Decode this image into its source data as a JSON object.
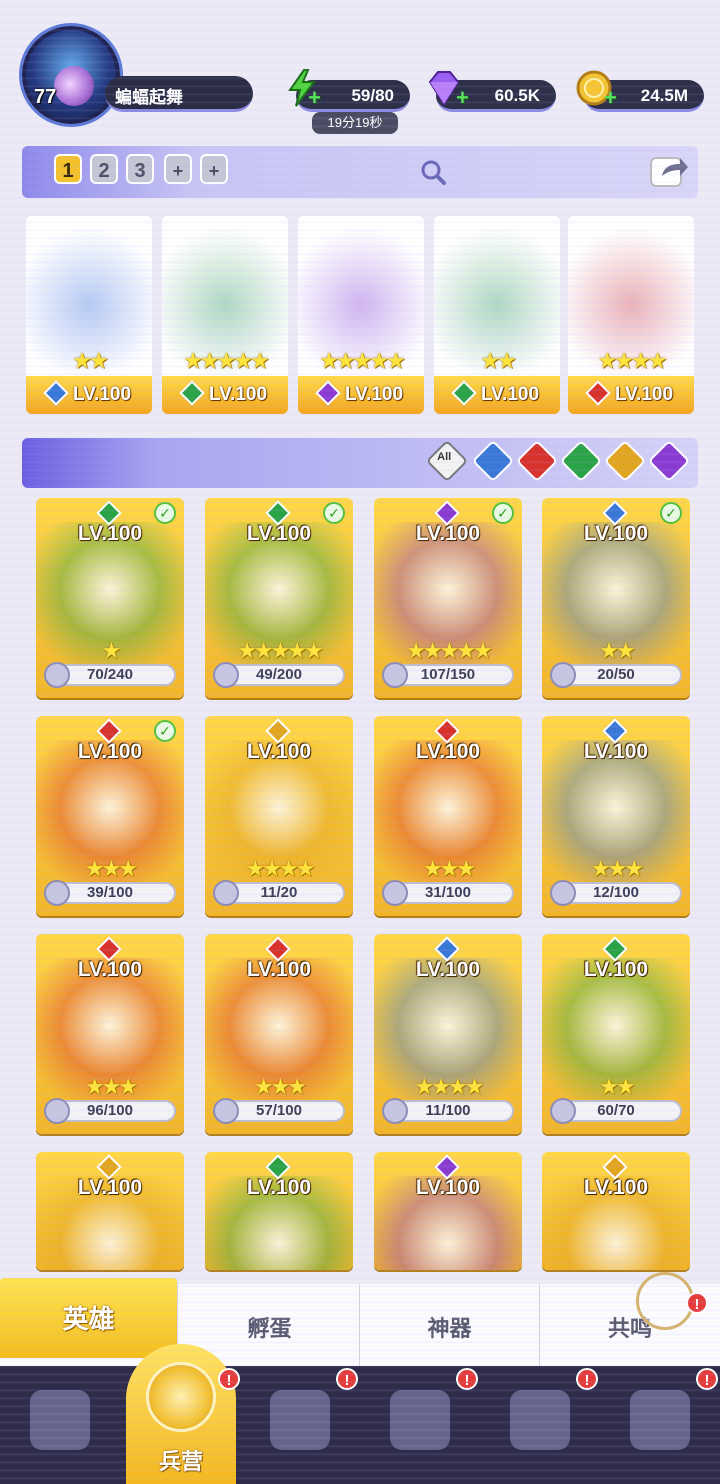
{
  "player": {
    "level": "77",
    "name": "蝙蝠起舞"
  },
  "resources": {
    "energy": {
      "value": "59/80",
      "timer": "19分19秒",
      "icon": "lightning-icon"
    },
    "gems": {
      "value": "60.5K",
      "icon": "gem-icon"
    },
    "coins": {
      "value": "24.5M",
      "icon": "coin-icon"
    }
  },
  "team_tabs": [
    "1",
    "2",
    "3",
    "+",
    "+"
  ],
  "team": [
    {
      "level": "LV.100",
      "stars": "★★",
      "element": "water",
      "color": "#3a78d8"
    },
    {
      "level": "LV.100",
      "stars": "★★★★★",
      "element": "nature",
      "color": "#2aa346"
    },
    {
      "level": "LV.100",
      "stars": "★★★★★",
      "element": "dark",
      "color": "#8a3bd0"
    },
    {
      "level": "LV.100",
      "stars": "★★",
      "element": "nature",
      "color": "#2aa346"
    },
    {
      "level": "LV.100",
      "stars": "★★★★",
      "element": "fire",
      "color": "#d8322c"
    }
  ],
  "filter": {
    "all_label": "All"
  },
  "heroes": [
    {
      "level": "LV.100",
      "shards": "70/240",
      "stars": "★",
      "element": "nature",
      "color": "#2aa346",
      "checked": true
    },
    {
      "level": "LV.100",
      "shards": "49/200",
      "stars": "★★★★★",
      "element": "nature",
      "color": "#2aa346",
      "checked": true
    },
    {
      "level": "LV.100",
      "shards": "107/150",
      "stars": "★★★★★",
      "element": "dark",
      "color": "#8a3bd0",
      "checked": true
    },
    {
      "level": "LV.100",
      "shards": "20/50",
      "stars": "★★",
      "element": "water",
      "color": "#3a78d8",
      "checked": true
    },
    {
      "level": "LV.100",
      "shards": "39/100",
      "stars": "★★★",
      "element": "fire",
      "color": "#d8322c",
      "checked": true
    },
    {
      "level": "LV.100",
      "shards": "11/20",
      "stars": "★★★★",
      "element": "light",
      "color": "#e2a51f",
      "checked": false
    },
    {
      "level": "LV.100",
      "shards": "31/100",
      "stars": "★★★",
      "element": "fire",
      "color": "#d8322c",
      "checked": false
    },
    {
      "level": "LV.100",
      "shards": "12/100",
      "stars": "★★★",
      "element": "water",
      "color": "#3a78d8",
      "checked": false
    },
    {
      "level": "LV.100",
      "shards": "96/100",
      "stars": "★★★",
      "element": "fire",
      "color": "#d8322c",
      "checked": false
    },
    {
      "level": "LV.100",
      "shards": "57/100",
      "stars": "★★★",
      "element": "fire",
      "color": "#d8322c",
      "checked": false
    },
    {
      "level": "LV.100",
      "shards": "11/100",
      "stars": "★★★★",
      "element": "water",
      "color": "#3a78d8",
      "checked": false
    },
    {
      "level": "LV.100",
      "shards": "60/70",
      "stars": "★★",
      "element": "nature",
      "color": "#2aa346",
      "checked": false
    },
    {
      "level": "LV.100",
      "shards": "",
      "stars": "",
      "element": "light",
      "color": "#e2a51f",
      "checked": false
    },
    {
      "level": "LV.100",
      "shards": "",
      "stars": "",
      "element": "nature",
      "color": "#2aa346",
      "checked": false
    },
    {
      "level": "LV.100",
      "shards": "",
      "stars": "",
      "element": "dark",
      "color": "#8a3bd0",
      "checked": false
    },
    {
      "level": "LV.100",
      "shards": "",
      "stars": "",
      "element": "light",
      "color": "#e2a51f",
      "checked": false
    }
  ],
  "sub_tabs": [
    "英雄",
    "孵蛋",
    "神器",
    "共鸣"
  ],
  "nav": {
    "active_label": "兵营",
    "badge": "!"
  },
  "colors": {
    "gold": "#f5b71f",
    "accent": "#8e89ea",
    "dark": "#2f2c4a"
  }
}
